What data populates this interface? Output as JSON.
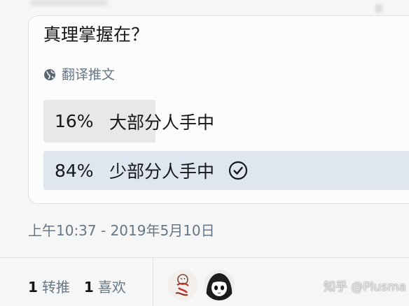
{
  "tweet": {
    "question": "真理掌握在？",
    "translate_label": "翻译推文",
    "translate_icon": "globe-icon",
    "poll": {
      "options": [
        {
          "percent_label": "16%",
          "label": "大部分人手中",
          "share": 0.16,
          "selected": false
        },
        {
          "percent_label": "84%",
          "label": "少部分人手中",
          "share": 0.84,
          "selected": true,
          "selected_icon": "check-circle-icon"
        }
      ]
    },
    "timestamp": "上午10:37 - 2019年5月10日",
    "stats": {
      "retweets_count": "1",
      "retweets_label": "转推",
      "likes_count": "1",
      "likes_label": "喜欢"
    },
    "liked_by_avatars": [
      "avatar-cartoon-sketch",
      "avatar-anime-girl"
    ]
  },
  "watermark": "知乎 @Plusma",
  "colors": {
    "text": "#14171a",
    "muted": "#657786",
    "poll_bar": "#e7e8ea",
    "poll_bar_selected": "#e0e6f0",
    "border": "#dfe1e3"
  }
}
